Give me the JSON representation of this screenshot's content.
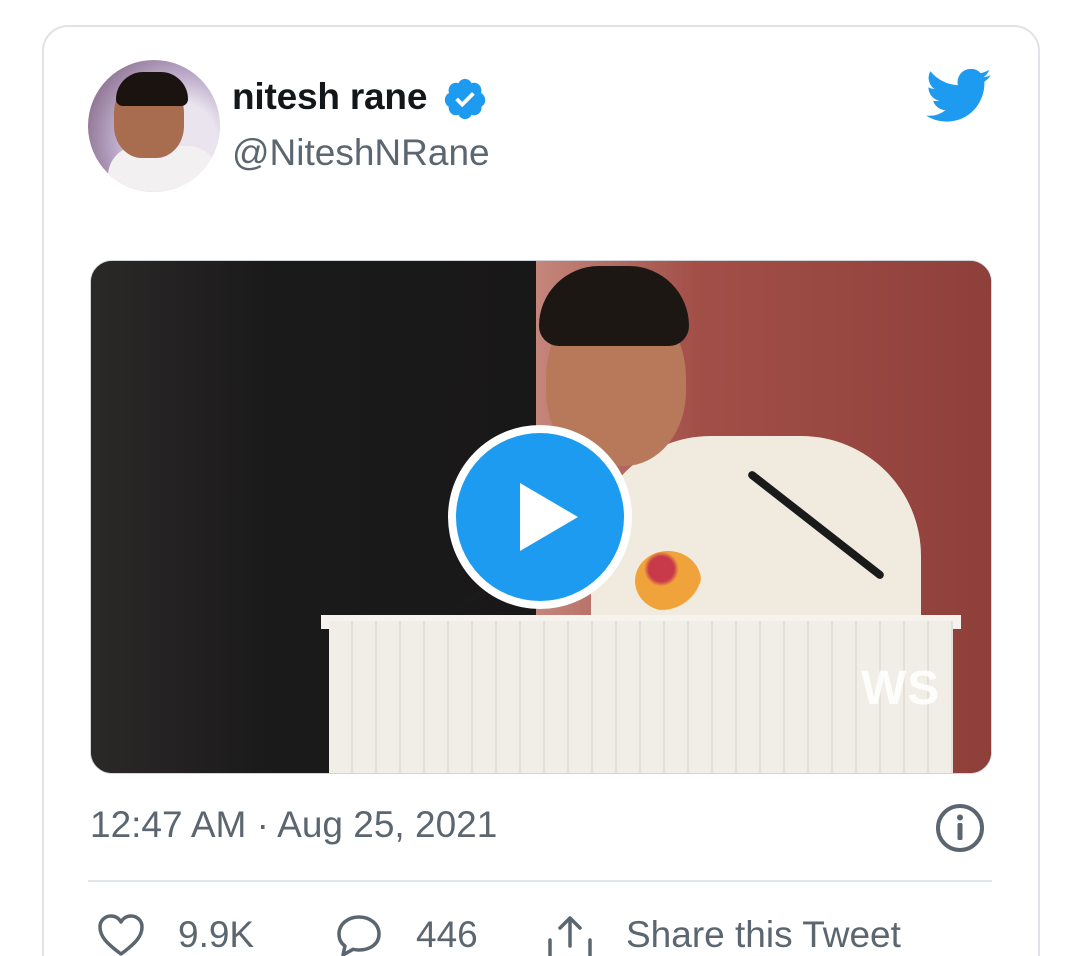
{
  "tweet": {
    "author_name": "nitesh rane",
    "author_handle": "@NiteshNRane",
    "verified": true,
    "timestamp": "12:47 AM · Aug 25, 2021",
    "media": {
      "type": "video",
      "watermark": "WS"
    }
  },
  "actions": {
    "likes": "9.9K",
    "replies": "446",
    "share_label": "Share this Tweet"
  },
  "icons": {
    "brand": "twitter-bird-icon",
    "verified": "verified-badge-icon",
    "play": "play-icon",
    "info": "info-icon",
    "like": "heart-icon",
    "reply": "reply-icon",
    "share": "share-icon"
  },
  "colors": {
    "accent": "#1d9bf0",
    "text_primary": "#14171a",
    "text_secondary": "#5b6670",
    "border": "#dfe3e7"
  }
}
